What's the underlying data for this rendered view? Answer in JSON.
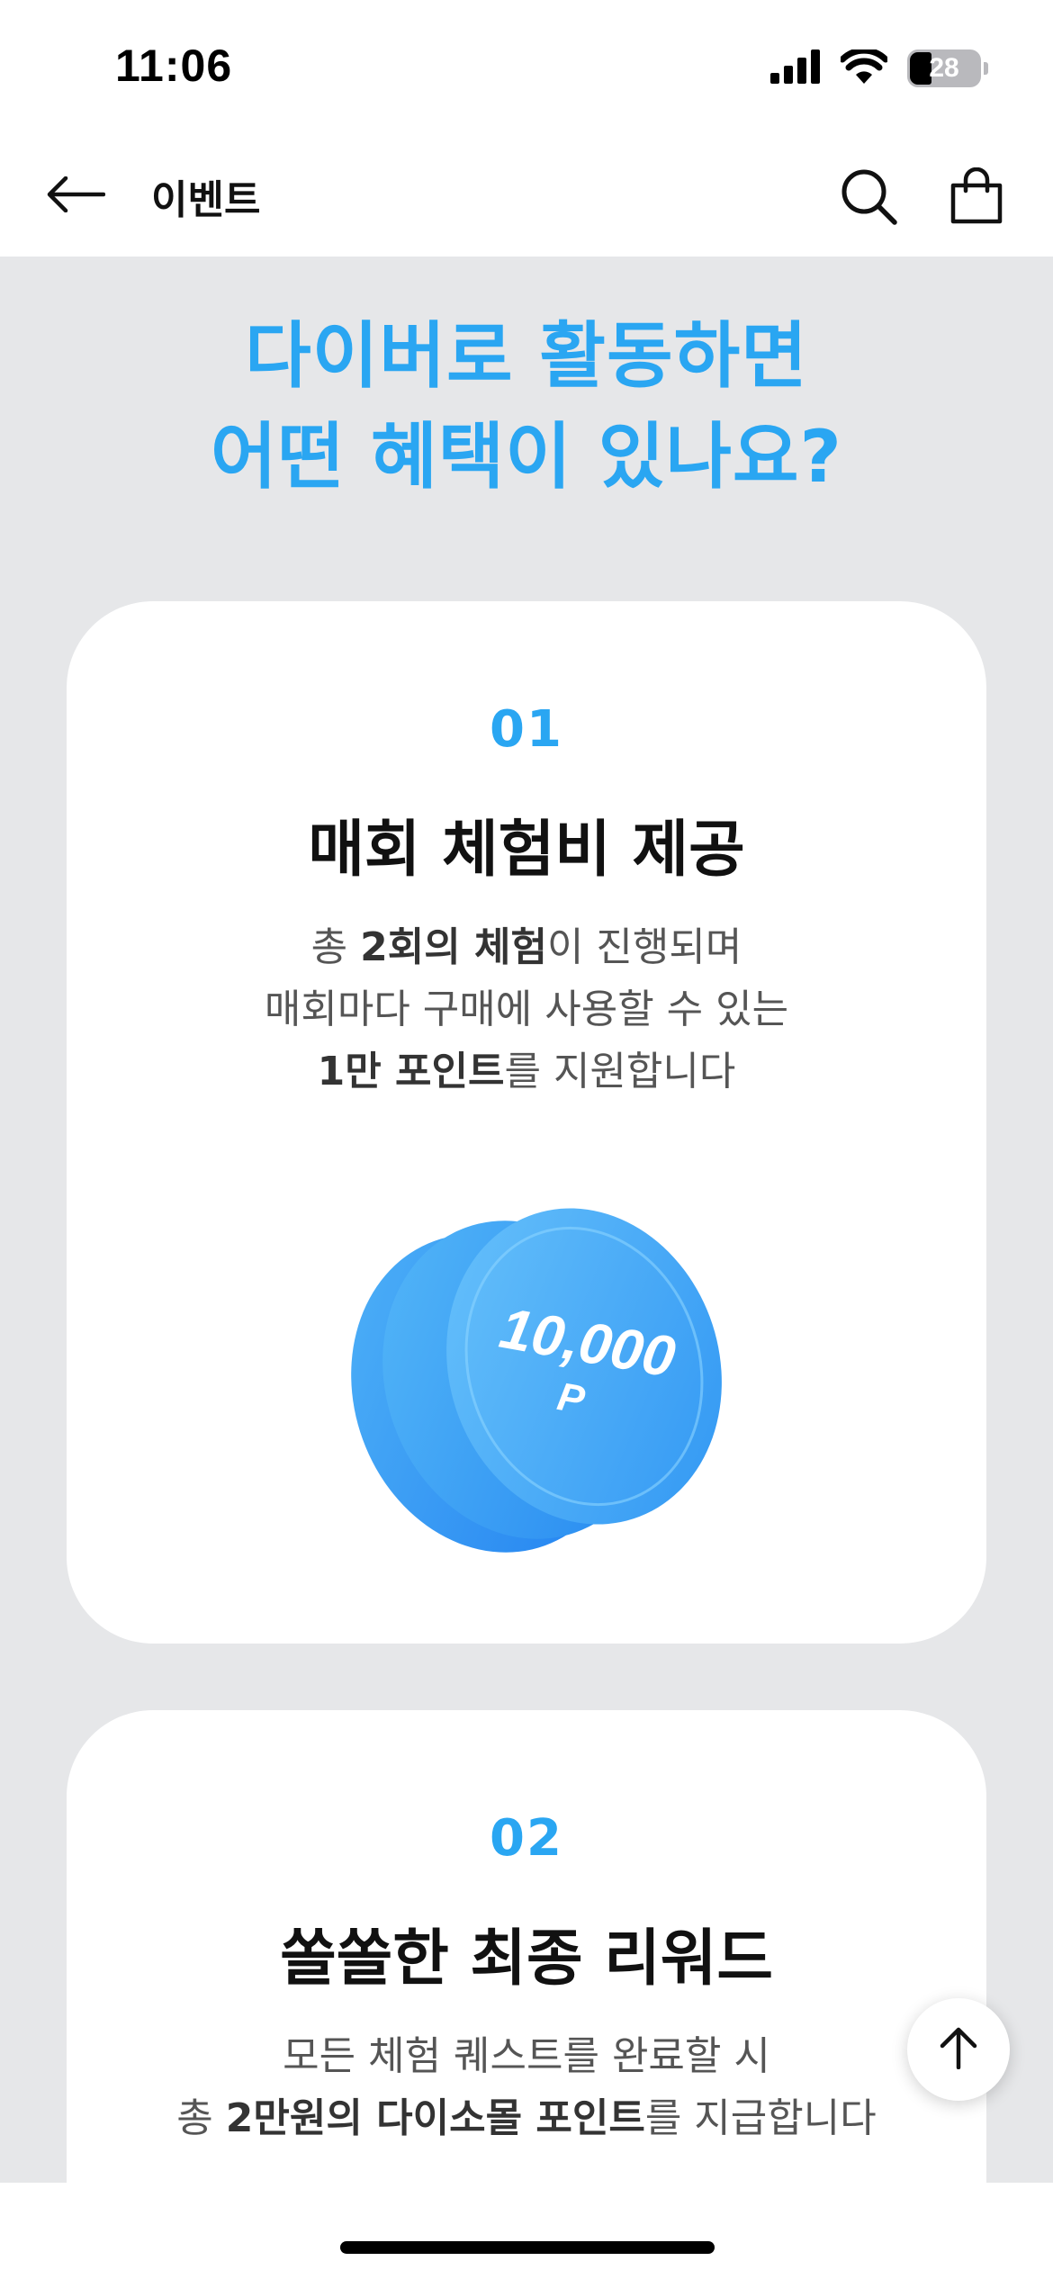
{
  "status_bar": {
    "time": "11:06",
    "battery_level": "28",
    "icons": [
      "signal-icon",
      "wifi-icon",
      "battery-icon"
    ]
  },
  "nav": {
    "title": "이벤트",
    "icons": [
      "back-arrow-icon",
      "search-icon",
      "shopping-bag-icon"
    ]
  },
  "hero": {
    "line1": "다이버로 활동하면",
    "line2": "어떤 혜택이 있나요?"
  },
  "colors": {
    "accent": "#2aa6f2",
    "background": "#e6e7e9",
    "card": "#ffffff"
  },
  "cards": [
    {
      "number": "01",
      "title": "매회 체험비 제공",
      "desc": [
        [
          {
            "t": "총 "
          },
          {
            "t": "2회의 체험",
            "b": true
          },
          {
            "t": "이 진행되며"
          }
        ],
        [
          {
            "t": "매회마다 구매에 사용할 수 있는"
          }
        ],
        [
          {
            "t": "1만 포인트",
            "b": true
          },
          {
            "t": "를 지원합니다"
          }
        ]
      ],
      "coin": {
        "amount": "10,000",
        "unit": "P"
      }
    },
    {
      "number": "02",
      "title": "쏠쏠한 최종 리워드",
      "desc": [
        [
          {
            "t": "모든 체험 퀘스트를 완료할 시"
          }
        ],
        [
          {
            "t": "총 "
          },
          {
            "t": "2만원의 다이소몰 포인트",
            "b": true
          },
          {
            "t": "를 지급합니다"
          }
        ]
      ]
    }
  ],
  "scroll_top": {
    "icon": "arrow-up-icon"
  }
}
